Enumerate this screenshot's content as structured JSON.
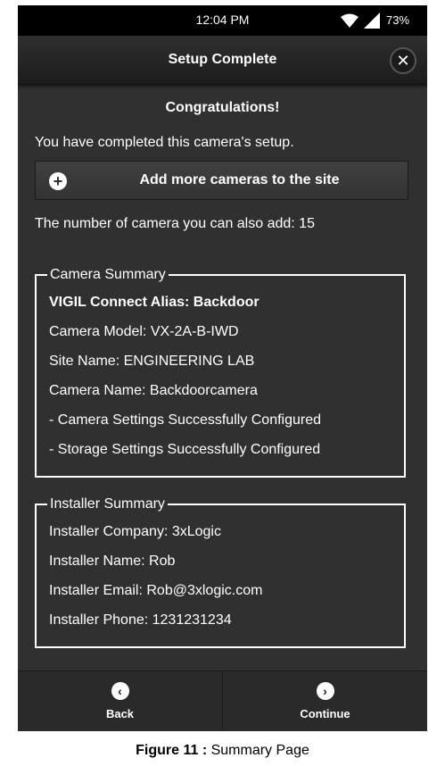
{
  "status_bar": {
    "time": "12:04 PM",
    "battery": "73%",
    "wifi_icon": "wifi-icon",
    "signal_icon": "signal-icon"
  },
  "header": {
    "title": "Setup Complete",
    "close_icon": "close-icon"
  },
  "content": {
    "congrats": "Congratulations!",
    "completed_text": "You have completed this camera's setup.",
    "add_cameras_button": "Add more cameras to the site",
    "camera_count_text": "The number of camera you can also add: 15"
  },
  "camera_summary": {
    "legend": "Camera Summary",
    "alias": "VIGIL Connect Alias: Backdoor",
    "model": "Camera Model: VX-2A-B-IWD",
    "site_name": "Site Name: ENGINEERING LAB",
    "camera_name": "Camera Name: Backdoorcamera",
    "camera_settings": "- Camera Settings Successfully Configured",
    "storage_settings": "- Storage Settings Successfully Configured"
  },
  "installer_summary": {
    "legend": "Installer Summary",
    "company": "Installer Company: 3xLogic",
    "name": "Installer Name: Rob",
    "email": "Installer Email: Rob@3xlogic.com",
    "phone": "Installer Phone: 1231231234"
  },
  "footer": {
    "back_label": "Back",
    "continue_label": "Continue"
  },
  "caption": {
    "label": "Figure 11 :",
    "text": " Summary Page"
  },
  "colors": {
    "background": "#303030",
    "header": "#1c1c1c",
    "text": "#ffffff"
  }
}
